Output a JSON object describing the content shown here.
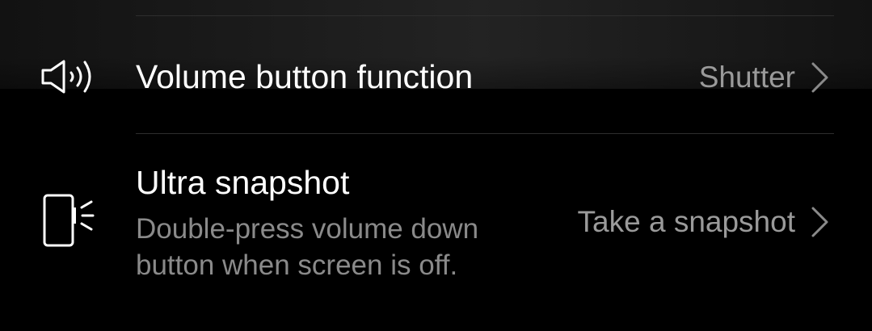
{
  "settings": {
    "volume_button": {
      "title": "Volume button function",
      "value": "Shutter",
      "icon": "speaker-icon"
    },
    "ultra_snapshot": {
      "title": "Ultra snapshot",
      "subtitle": "Double-press volume down button when screen is off.",
      "value": "Take a snapshot",
      "icon": "phone-button-icon"
    }
  },
  "colors": {
    "background": "#000000",
    "title": "#ffffff",
    "secondary": "#8a8a8a",
    "divider": "#2e2e2e"
  }
}
